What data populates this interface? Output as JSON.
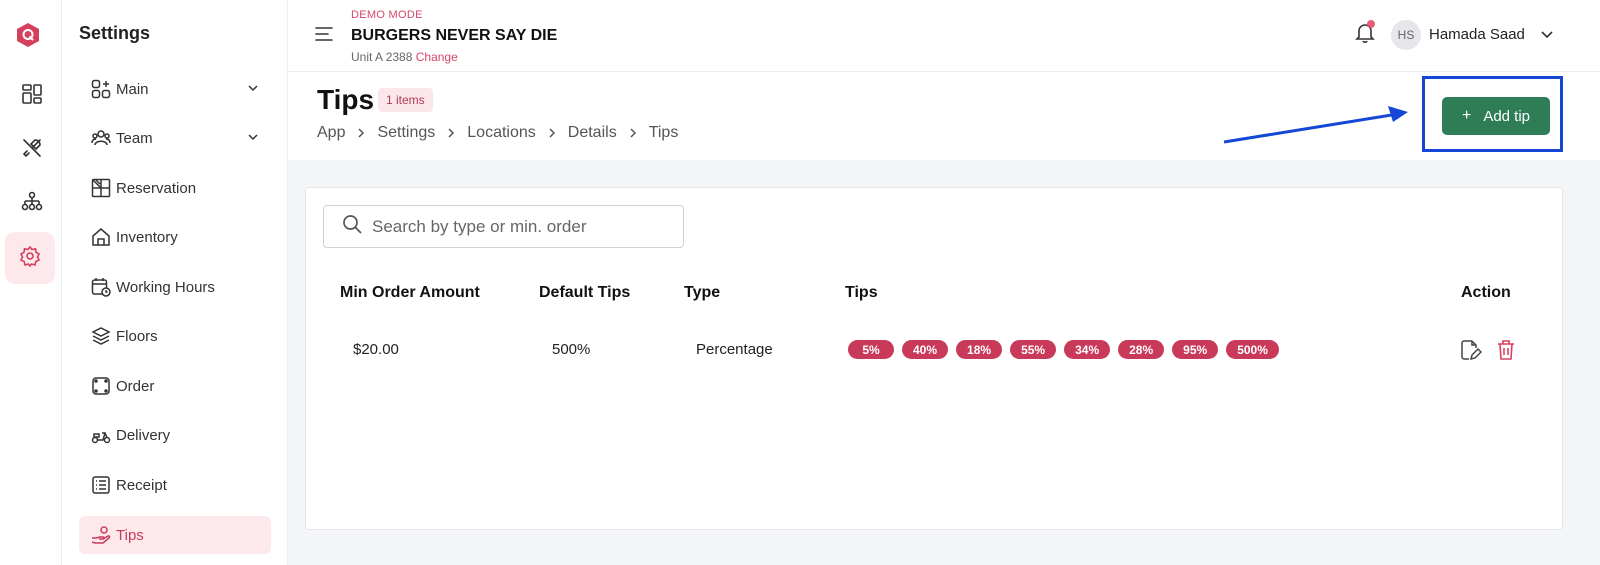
{
  "rail": {
    "items": [
      {
        "icon": "dashboard-icon"
      },
      {
        "icon": "utensils-icon"
      },
      {
        "icon": "hierarchy-icon"
      },
      {
        "icon": "gear-icon",
        "active": true
      }
    ]
  },
  "sidebar": {
    "title": "Settings",
    "items": [
      {
        "label": "Main",
        "icon": "apps-add-icon",
        "expandable": true
      },
      {
        "label": "Team",
        "icon": "team-icon",
        "expandable": true
      },
      {
        "label": "Reservation",
        "icon": "table-layout-icon"
      },
      {
        "label": "Inventory",
        "icon": "home-icon"
      },
      {
        "label": "Working Hours",
        "icon": "calendar-clock-icon"
      },
      {
        "label": "Floors",
        "icon": "layers-icon"
      },
      {
        "label": "Order",
        "icon": "order-frame-icon"
      },
      {
        "label": "Delivery",
        "icon": "scooter-icon"
      },
      {
        "label": "Receipt",
        "icon": "receipt-list-icon"
      },
      {
        "label": "Tips",
        "icon": "hand-coin-icon",
        "active": true
      }
    ]
  },
  "topbar": {
    "mode": "DEMO MODE",
    "restaurant": "BURGERS NEVER SAY DIE",
    "unit": "Unit A 2388",
    "change": "Change",
    "avatar": "HS",
    "user": "Hamada Saad"
  },
  "page": {
    "title": "Tips",
    "count": "1 items",
    "breadcrumb": [
      "App",
      "Settings",
      "Locations",
      "Details",
      "Tips"
    ],
    "add_button": "Add tip"
  },
  "search": {
    "placeholder": "Search by type or min. order"
  },
  "table": {
    "headers": {
      "min_order": "Min Order Amount",
      "default_tips": "Default Tips",
      "type": "Type",
      "tips": "Tips",
      "action": "Action"
    },
    "rows": [
      {
        "min_order": "$20.00",
        "default_tips": "500%",
        "type": "Percentage",
        "tips": [
          "5%",
          "40%",
          "18%",
          "55%",
          "34%",
          "28%",
          "95%",
          "500%"
        ]
      }
    ]
  },
  "colors": {
    "accent": "#c93a5a",
    "primary_button": "#2e7d57",
    "highlight": "#1547d6"
  }
}
